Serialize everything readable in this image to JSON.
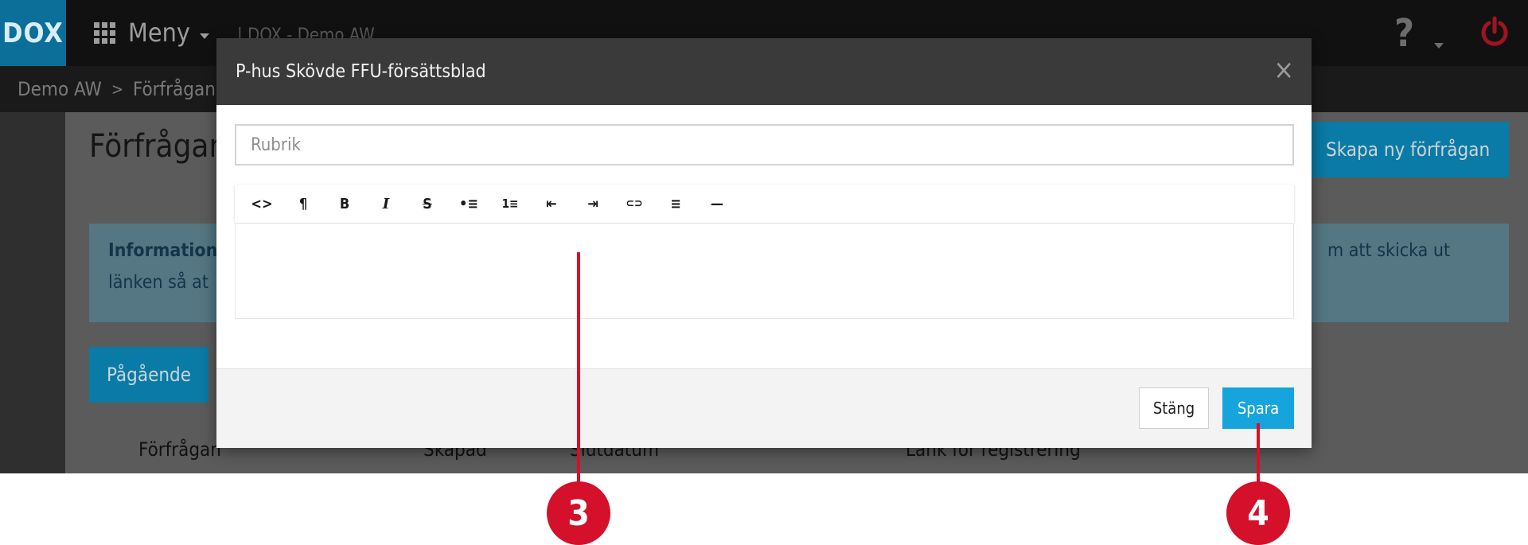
{
  "topbar": {
    "logo": "DOX",
    "menu_label": "Meny",
    "app_crumb": "| DOX - Demo AW",
    "help_glyph": "?"
  },
  "breadcrumb": {
    "root": "Demo AW",
    "current": "Förfrågan"
  },
  "page": {
    "title": "Förfrågan",
    "new_button": "Skapa ny förfrågan",
    "info_line1_bold": "Information:",
    "info_line1_right": "m att skicka ut",
    "info_line2": "länken så at",
    "tab_active": "Pågående",
    "columns": [
      "Förfrågan",
      "Skapad",
      "Slutdatum",
      "Länk för registrering"
    ]
  },
  "modal": {
    "title": "P-hus Skövde FFU-försättsblad",
    "close_glyph": "×",
    "title_input": {
      "value": "",
      "placeholder": "Rubrik"
    },
    "toolbar": [
      {
        "name": "code-icon",
        "glyph": "<>"
      },
      {
        "name": "paragraph-icon",
        "glyph": "¶"
      },
      {
        "name": "bold-icon",
        "glyph": "B"
      },
      {
        "name": "italic-icon",
        "glyph": "I"
      },
      {
        "name": "strikethrough-icon",
        "glyph": "S"
      },
      {
        "name": "bullet-list-icon",
        "glyph": "•≡"
      },
      {
        "name": "numbered-list-icon",
        "glyph": "1≡"
      },
      {
        "name": "outdent-icon",
        "glyph": "⇤"
      },
      {
        "name": "indent-icon",
        "glyph": "⇥"
      },
      {
        "name": "link-icon",
        "glyph": "⊂⊃"
      },
      {
        "name": "align-left-icon",
        "glyph": "≡"
      },
      {
        "name": "horizontal-rule-icon",
        "glyph": "—"
      }
    ],
    "close_button": "Stäng",
    "save_button": "Spara"
  },
  "callouts": {
    "editor": "3",
    "save": "4"
  },
  "colors": {
    "accent": "#16a4dc",
    "callout": "#d5102a",
    "modal_header": "#3a3a3a"
  }
}
